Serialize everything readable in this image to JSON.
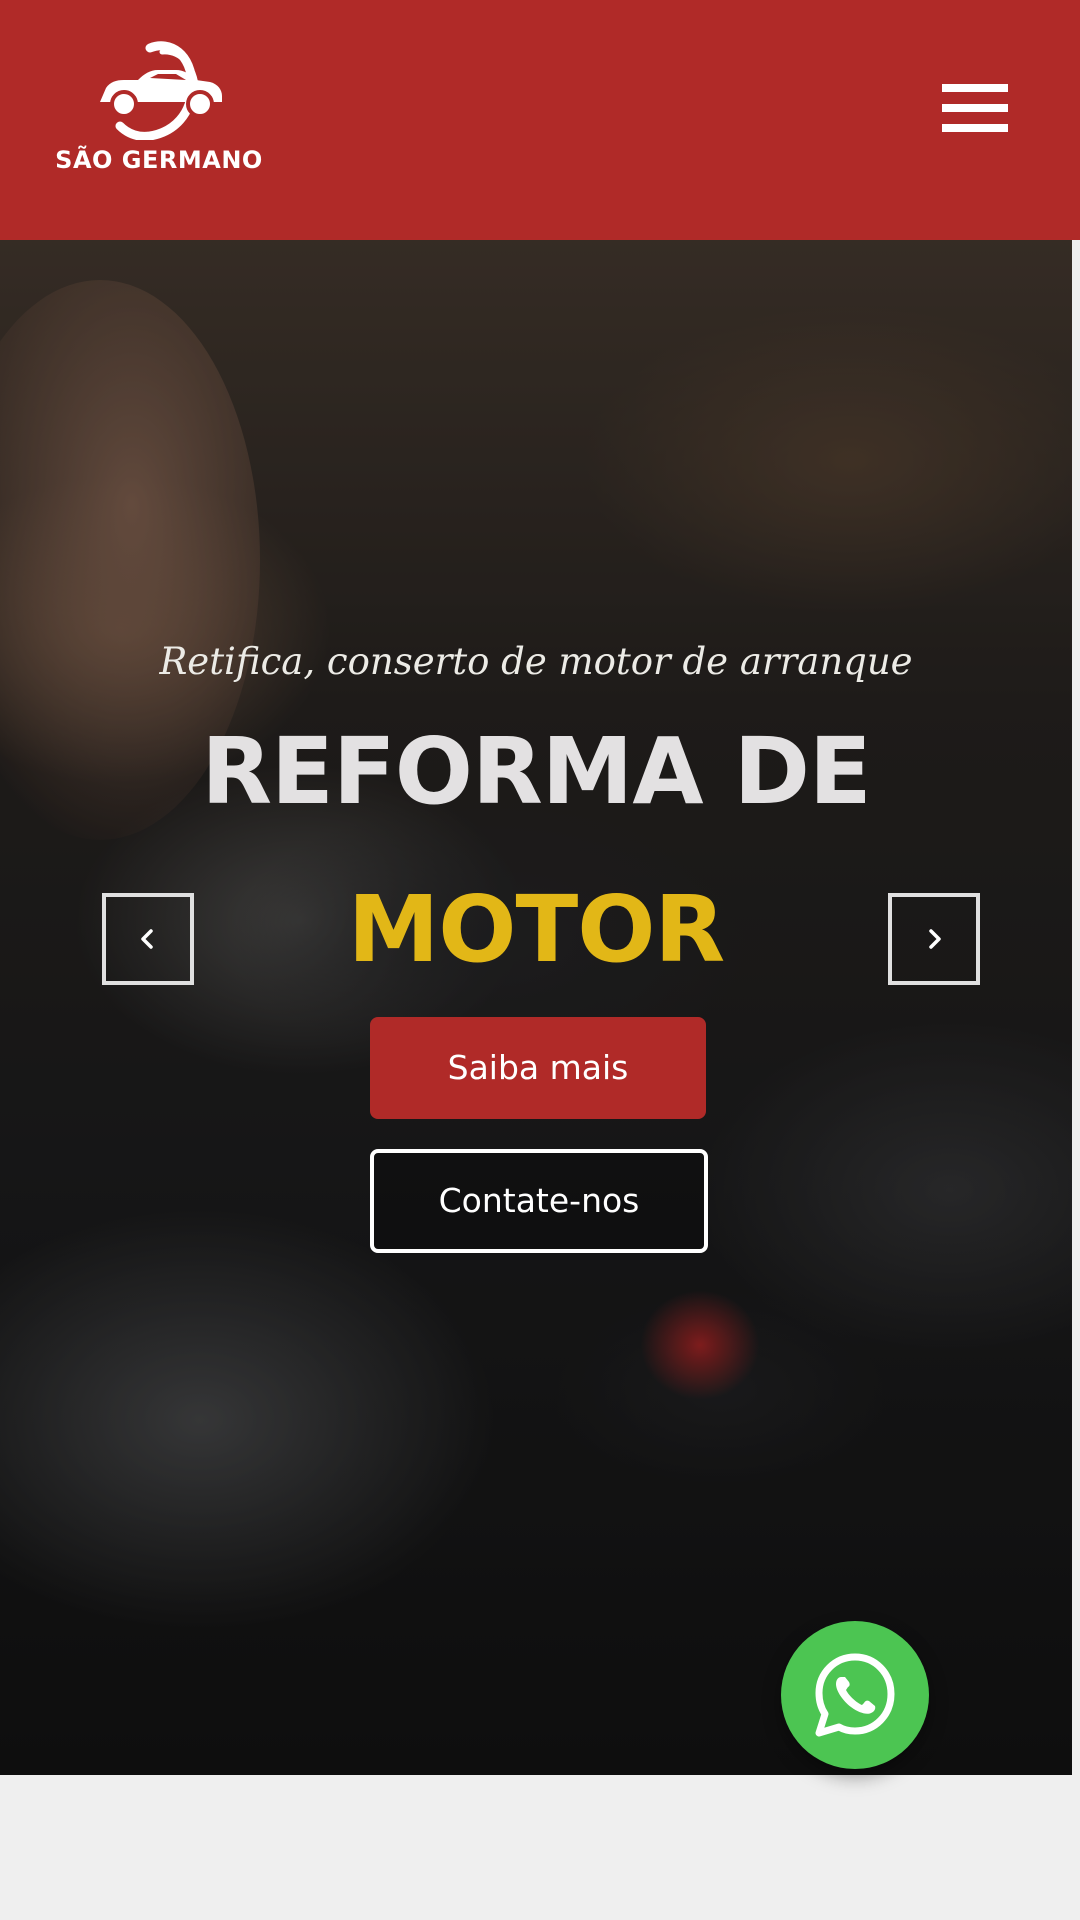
{
  "header": {
    "brand": "SÃO GERMANO",
    "brand_color": "#b02a28",
    "logo_icon": "car-icon",
    "menu_icon": "hamburger-menu-icon"
  },
  "hero": {
    "subtitle": "Retifica, conserto de motor de arranque",
    "headline_line1": "REFORMA DE",
    "headline_line2": "MOTOR",
    "headline_accent_color": "#e2b717",
    "primary_button": "Saiba mais",
    "secondary_button": "Contate-nos",
    "prev_icon": "chevron-left-icon",
    "next_icon": "chevron-right-icon"
  },
  "floating": {
    "whatsapp_icon": "whatsapp-icon",
    "whatsapp_color": "#4cc552"
  }
}
